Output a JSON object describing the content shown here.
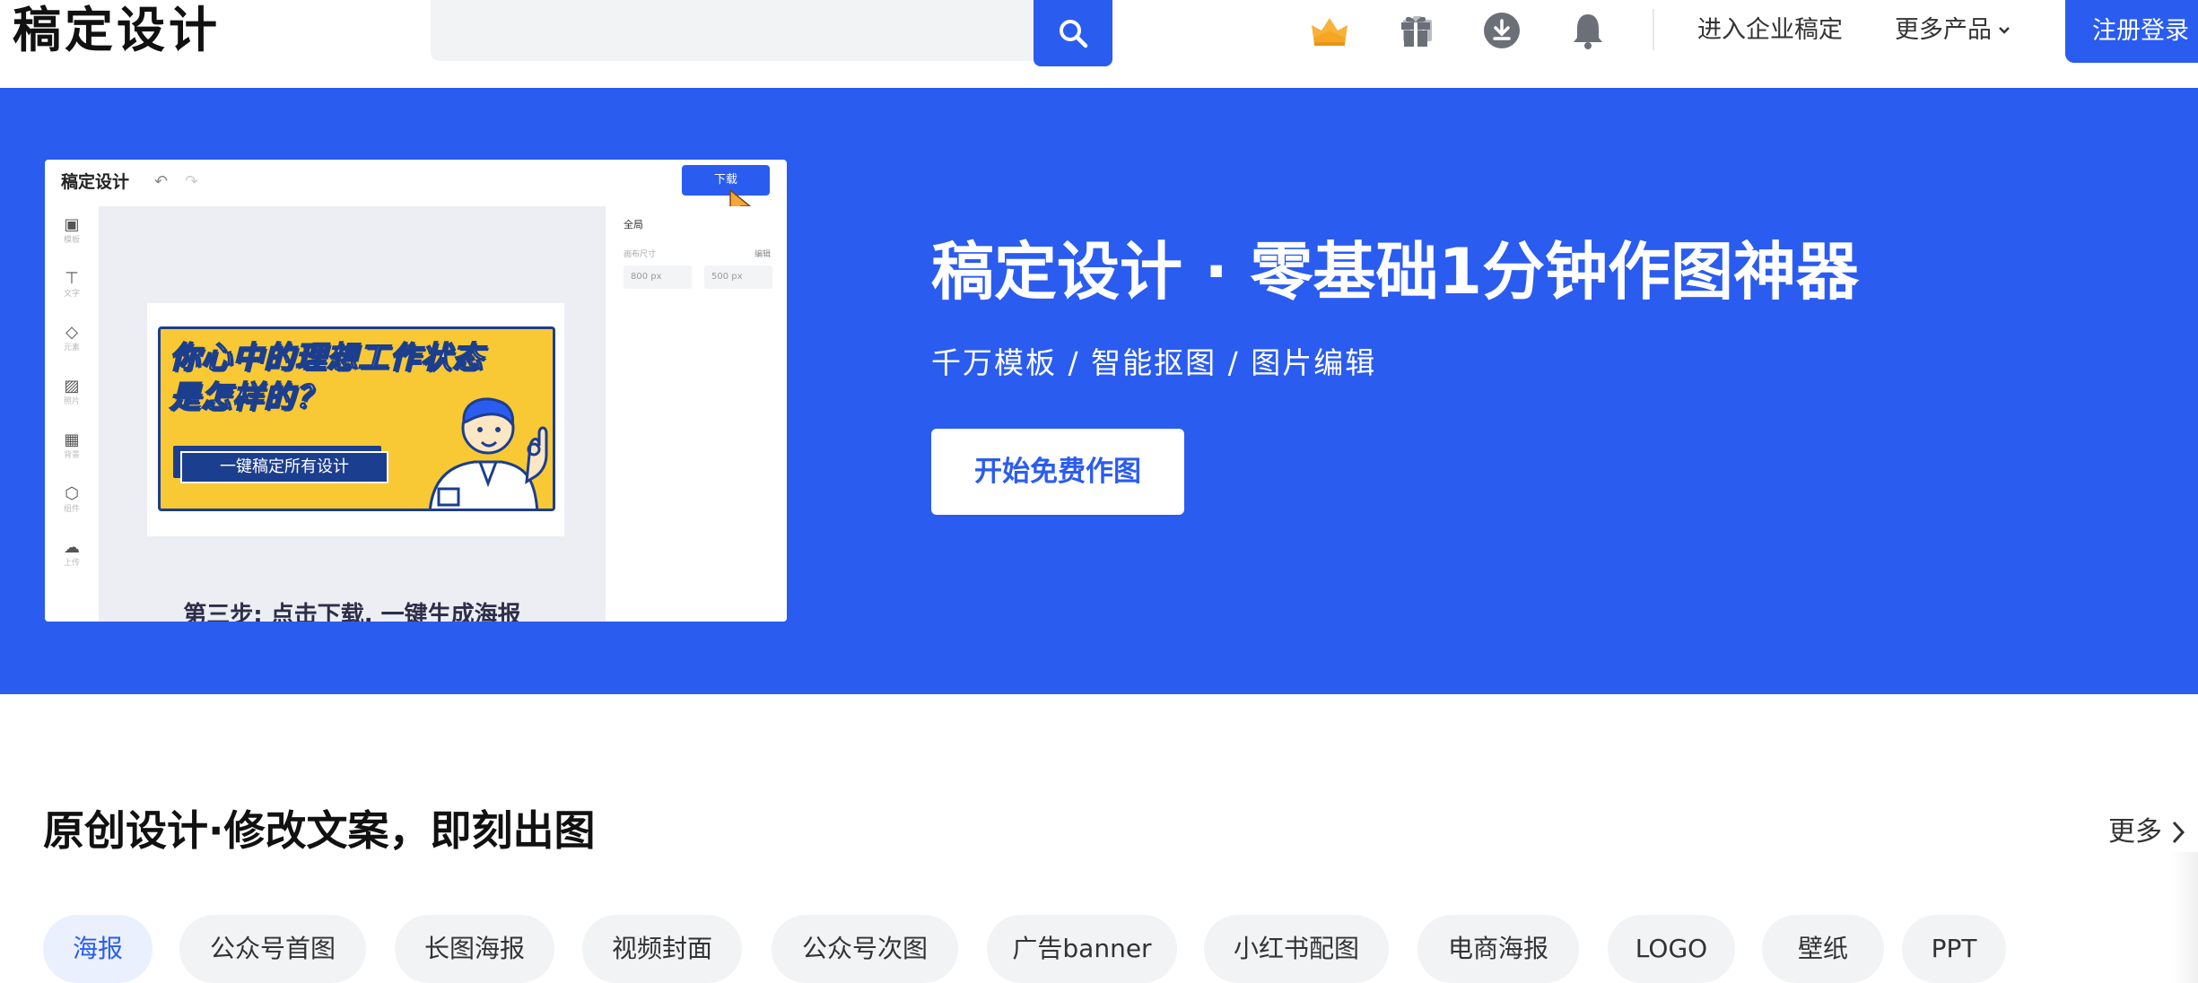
{
  "header": {
    "logo": "稿定设计",
    "search_placeholder": "",
    "enterprise_link": "进入企业稿定",
    "more_products": "更多产品",
    "login_button": "注册登录"
  },
  "hero": {
    "title": "稿定设计 · 零基础1分钟作图神器",
    "subtitle": "千万模板 / 智能抠图 / 图片编辑",
    "cta": "开始免费作图",
    "mockup": {
      "app_title": "稿定设计",
      "download_button": "下载",
      "sidebar": [
        "模板",
        "文字",
        "元素",
        "照片",
        "背景",
        "组件",
        "上传"
      ],
      "panel_heading": "全局",
      "panel_size_label": "画布尺寸",
      "panel_edit": "编辑",
      "width_value": "800 px",
      "height_value": "500 px",
      "poster_title": "你心中的理想工作状态\n是怎样的？",
      "poster_button": "一键稿定所有设计",
      "step_text": "第三步: 点击下载, 一键生成海报"
    }
  },
  "section": {
    "title": "原创设计·修改文案，即刻出图",
    "more": "更多",
    "tags": [
      "海报",
      "公众号首图",
      "长图海报",
      "视频封面",
      "公众号次图",
      "广告banner",
      "小红书配图",
      "电商海报",
      "LOGO",
      "壁纸",
      "PPT"
    ],
    "active_tag": "海报"
  },
  "colors": {
    "brand_blue": "#2b5cf0",
    "poster_yellow": "#f8c934",
    "poster_navy": "#1c3e8e"
  }
}
